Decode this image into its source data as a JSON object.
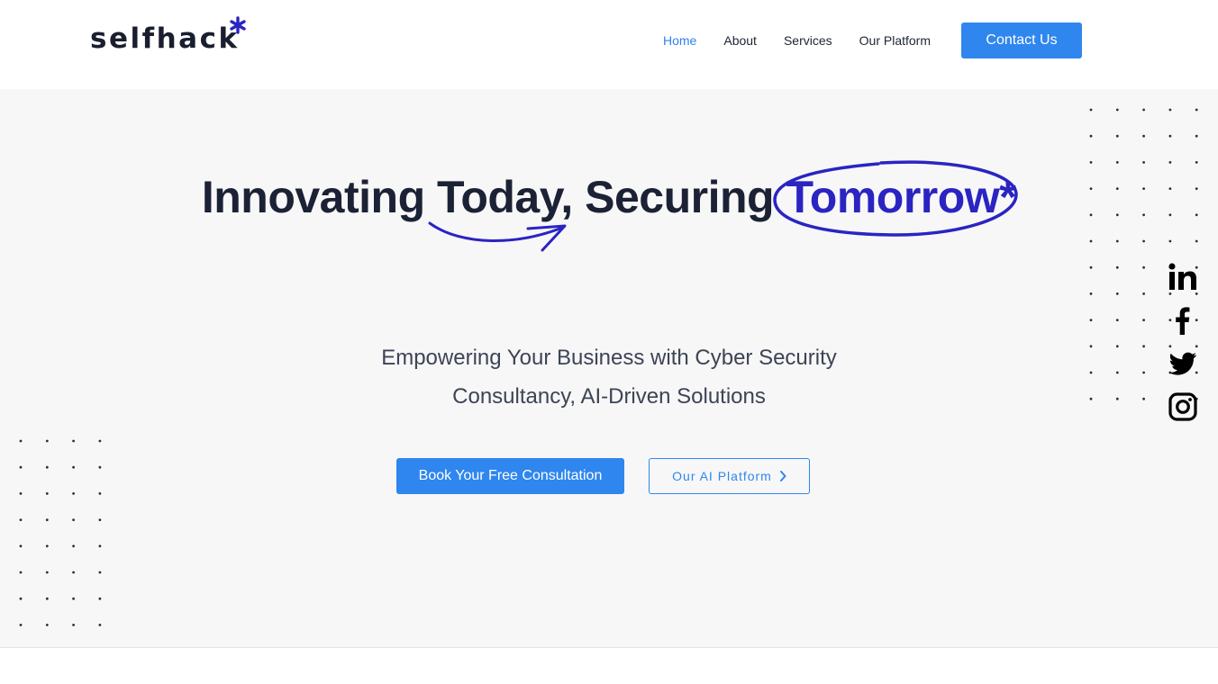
{
  "header": {
    "logo_text": "selfhack",
    "nav": [
      {
        "label": "Home",
        "active": true
      },
      {
        "label": "About",
        "active": false
      },
      {
        "label": "Services",
        "active": false
      },
      {
        "label": "Our Platform",
        "active": false
      }
    ],
    "contact_label": "Contact Us"
  },
  "hero": {
    "headline_main": "Innovating Today, Securing ",
    "headline_accent": "Tomorrow*",
    "subline_1": "Empowering Your Business with Cyber Security",
    "subline_2": "Consultancy, AI-Driven Solutions",
    "primary_cta": "Book Your Free Consultation",
    "secondary_cta": "Our AI Platform"
  },
  "social": [
    {
      "icon": "linkedin-icon"
    },
    {
      "icon": "facebook-icon"
    },
    {
      "icon": "twitter-icon"
    },
    {
      "icon": "instagram-icon"
    }
  ],
  "colors": {
    "accent": "#2f86ee",
    "brand_indigo": "#2a24c2",
    "hero_bg": "#f7f7f7"
  }
}
